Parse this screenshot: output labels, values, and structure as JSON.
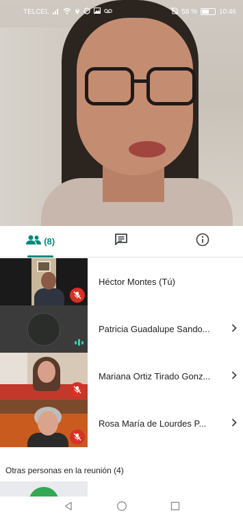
{
  "status_bar": {
    "carrier": "TELCEL",
    "battery_text": "58 %",
    "battery_level": 0.58,
    "time": "10:46"
  },
  "tabs": {
    "people_count": "(8)",
    "active": "people",
    "icons": [
      "people-icon",
      "chat-icon",
      "info-icon"
    ]
  },
  "participants": [
    {
      "name": "Héctor Montes (Tú)",
      "muted": true,
      "chevron": false
    },
    {
      "name": "Patricia Guadalupe Sando...",
      "muted": false,
      "speaking": true,
      "chevron": true
    },
    {
      "name": "Mariana Ortiz Tirado Gonz...",
      "muted": true,
      "chevron": true
    },
    {
      "name": "Rosa María de Lourdes P...",
      "muted": true,
      "chevron": true
    }
  ],
  "section": {
    "others_label": "Otras personas en la reunión (4)"
  },
  "colors": {
    "accent": "#00897b",
    "mute_red": "#d93025",
    "speaking": "#2bd4b4"
  },
  "navbar": {
    "icons": [
      "back-icon",
      "home-icon",
      "recents-icon"
    ]
  }
}
